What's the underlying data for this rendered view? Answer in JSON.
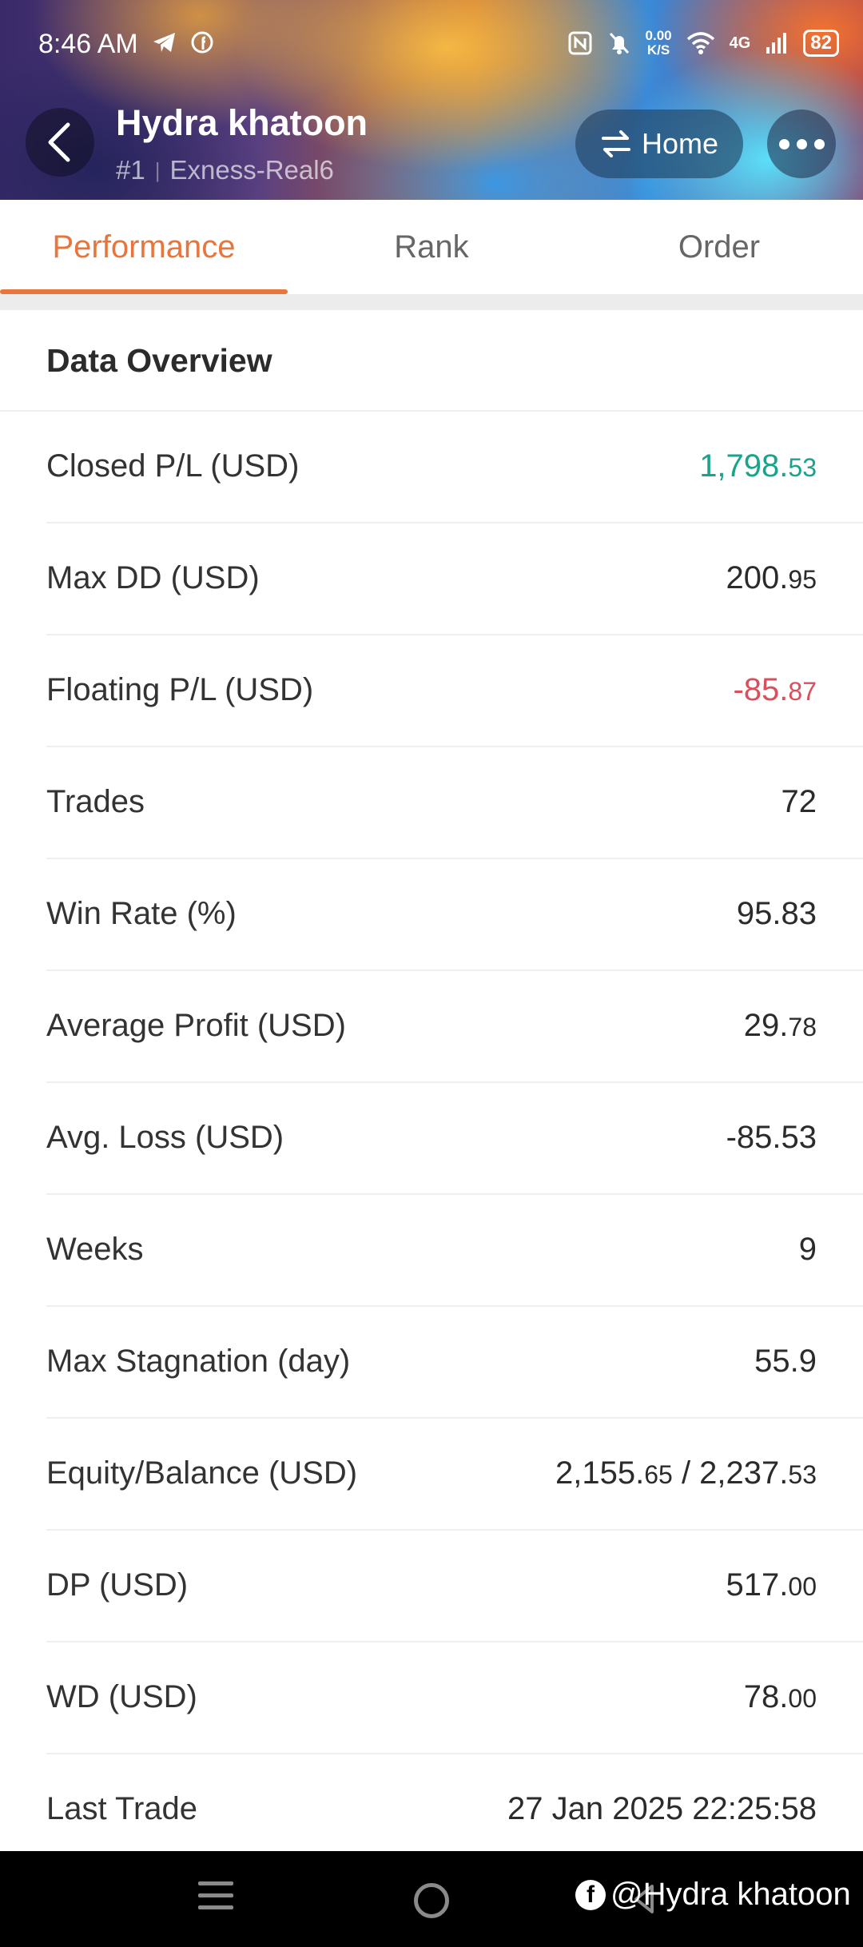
{
  "status": {
    "time": "8:46 AM",
    "net_speed_top": "0.00",
    "net_speed_bottom": "K/S",
    "network": "4G",
    "battery": "82"
  },
  "header": {
    "title": "Hydra khatoon",
    "rank_tag": "#1",
    "account": "Exness-Real6",
    "home_label": "Home"
  },
  "tabs": [
    {
      "label": "Performance",
      "active": true
    },
    {
      "label": "Rank",
      "active": false
    },
    {
      "label": "Order",
      "active": false
    }
  ],
  "section": {
    "title": "Data Overview"
  },
  "rows": [
    {
      "label": "Closed P/L (USD)",
      "major": "1,798.",
      "minor": "53",
      "tone": "positive"
    },
    {
      "label": "Max DD (USD)",
      "major": "200.",
      "minor": "95",
      "tone": "neutral"
    },
    {
      "label": "Floating P/L (USD)",
      "major": "-85.",
      "minor": "87",
      "tone": "negative"
    },
    {
      "label": "Trades",
      "major": "72",
      "minor": "",
      "tone": "neutral"
    },
    {
      "label": "Win Rate (%)",
      "major": "95.83",
      "minor": "",
      "tone": "neutral"
    },
    {
      "label": "Average Profit (USD)",
      "major": "29.",
      "minor": "78",
      "tone": "neutral"
    },
    {
      "label": "Avg. Loss (USD)",
      "major": "-85.53",
      "minor": "",
      "tone": "neutral"
    },
    {
      "label": "Weeks",
      "major": "9",
      "minor": "",
      "tone": "neutral"
    },
    {
      "label": "Max Stagnation (day)",
      "major": "55.9",
      "minor": "",
      "tone": "neutral"
    },
    {
      "label": "Equity/Balance (USD)",
      "major": "2,155.",
      "minor": "65",
      "major2": " / 2,237.",
      "minor2": "53",
      "tone": "neutral"
    },
    {
      "label": "DP (USD)",
      "major": "517.",
      "minor": "00",
      "tone": "neutral"
    },
    {
      "label": "WD (USD)",
      "major": "78.",
      "minor": "00",
      "tone": "neutral"
    },
    {
      "label": "Last Trade",
      "major": "27 Jan 2025 22:25:58",
      "minor": "",
      "tone": "neutral"
    }
  ],
  "watermark": "@Hydra khatoon",
  "colors": {
    "accent": "#e8753b",
    "positive": "#19a38b",
    "negative": "#d8505c"
  }
}
